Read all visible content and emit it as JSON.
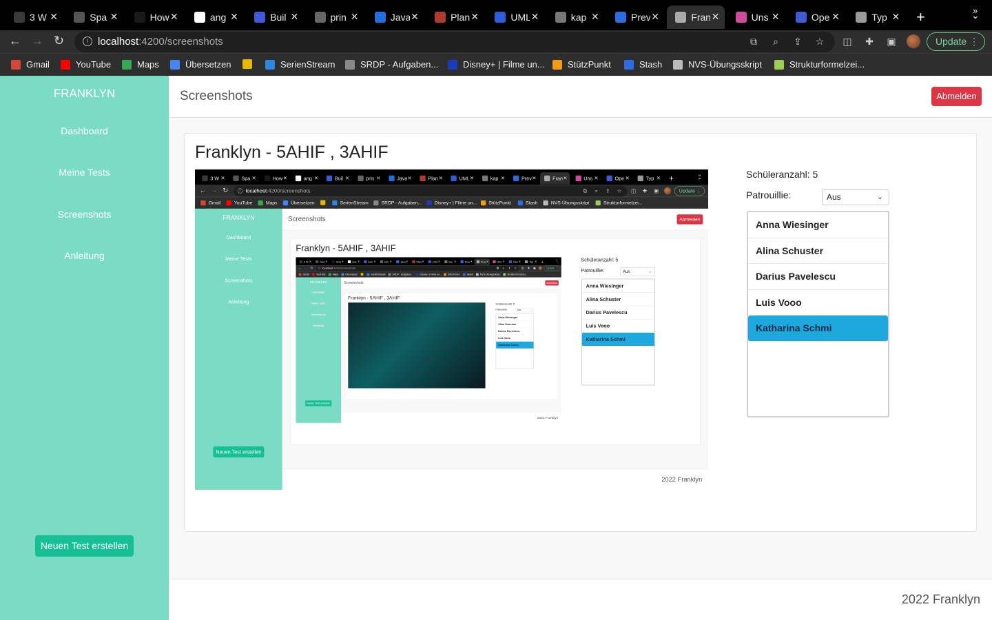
{
  "browser": {
    "tabs": [
      {
        "label": "3 W",
        "color": "#3a3a3a"
      },
      {
        "label": "Spa",
        "color": "#555555"
      },
      {
        "label": "How",
        "color": "#1a1a1a"
      },
      {
        "label": "ang",
        "color": "#ffffff"
      },
      {
        "label": "Buil",
        "color": "#3d5bd6"
      },
      {
        "label": "prin",
        "color": "#666666"
      },
      {
        "label": "Java",
        "color": "#1f6fe0"
      },
      {
        "label": "Plan",
        "color": "#b03a2e"
      },
      {
        "label": "UML",
        "color": "#2b5ed8"
      },
      {
        "label": "kap",
        "color": "#777777"
      },
      {
        "label": "Prev",
        "color": "#2d6be2"
      },
      {
        "label": "Fran",
        "color": "#aaaaaa"
      },
      {
        "label": "Uns",
        "color": "#d04ba0"
      },
      {
        "label": "Ope",
        "color": "#3d5bd6"
      },
      {
        "label": "Typ",
        "color": "#999999"
      }
    ],
    "url_host": "localhost",
    "url_path": ":4200/screenshots",
    "update_label": "Update",
    "bookmarks": [
      {
        "label": "Gmail",
        "color": "#d44638"
      },
      {
        "label": "YouTube",
        "color": "#ff0000"
      },
      {
        "label": "Maps",
        "color": "#34a853"
      },
      {
        "label": "Übersetzen",
        "color": "#4285f4"
      },
      {
        "label": "",
        "color": "#e6b800"
      },
      {
        "label": "SerienStream",
        "color": "#2e86de"
      },
      {
        "label": "SRDP - Aufgaben...",
        "color": "#888888"
      },
      {
        "label": "Disney+ | Filme un...",
        "color": "#1b3cb8"
      },
      {
        "label": "StützPunkt",
        "color": "#f39c12"
      },
      {
        "label": "Stash",
        "color": "#2e6de0"
      },
      {
        "label": "NVS-Übungsskript",
        "color": "#bbbbbb"
      },
      {
        "label": "Strukturformelzei...",
        "color": "#9bcf53"
      }
    ]
  },
  "app": {
    "brand": "FRANKLYN",
    "nav": [
      "Dashboard",
      "Meine Tests",
      "Screenshots",
      "Anleitung"
    ],
    "new_test_label": "Neuen Test erstellen",
    "page_title": "Screenshots",
    "logout_label": "Abmelden",
    "card_title": "Franklyn - 5AHIF , 3AHIF",
    "student_count_label": "Schüleranzahl: 5",
    "patrol_label": "Patrouillie:",
    "patrol_value": "Aus",
    "students": [
      "Anna Wiesinger",
      "Alina Schuster",
      "Darius Pavelescu",
      "Luis Vooo",
      "Katharina Schmi"
    ],
    "selected_student": "Katharina Schmi",
    "footer": "2022 Franklyn"
  },
  "colors": {
    "sidebar": "#7adcc4",
    "accent_button": "#16bf94",
    "danger": "#dc3545",
    "selected": "#1fa8dd"
  }
}
